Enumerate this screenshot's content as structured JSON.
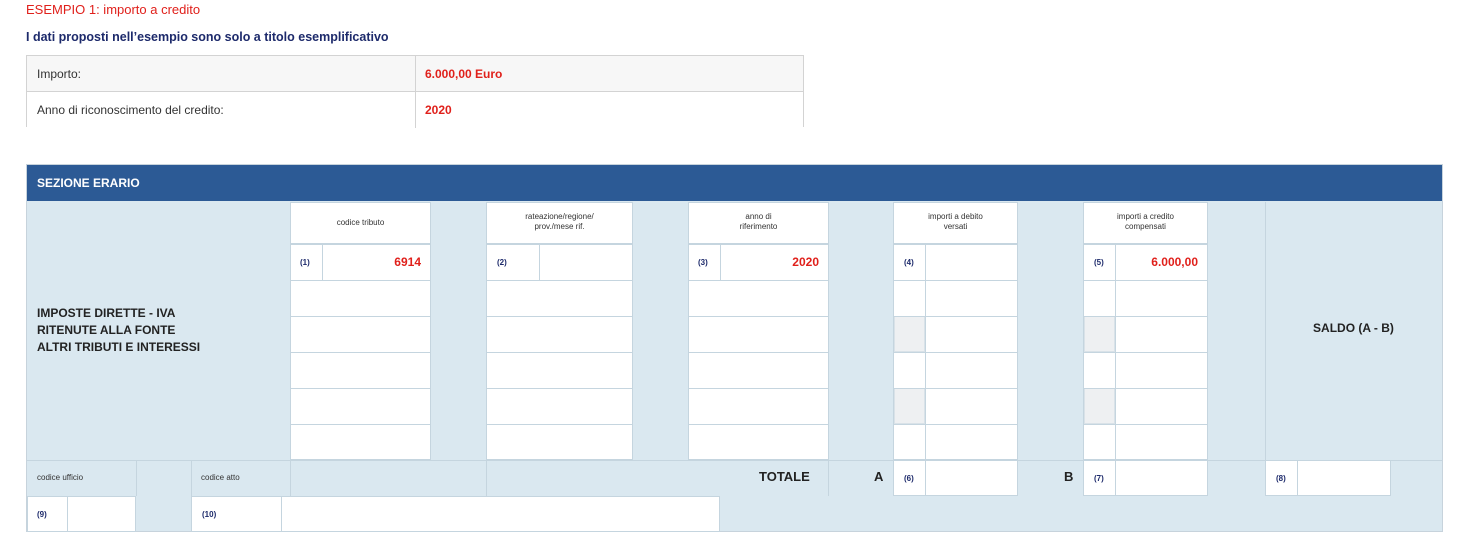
{
  "heading": "ESEMPIO 1: importo a credito",
  "subheading": "I dati proposti nell’esempio sono solo a titolo esemplificativo",
  "info": {
    "rows": [
      {
        "label": "Importo:",
        "value": "6.000,00 Euro"
      },
      {
        "label": "Anno di riconoscimento del credito:",
        "value": "2020"
      }
    ]
  },
  "section": {
    "title": "SEZIONE ERARIO",
    "left_label": {
      "line1": "IMPOSTE DIRETTE - IVA",
      "line2": "RITENUTE ALLA FONTE",
      "line3": "ALTRI TRIBUTI E INTERESSI"
    },
    "columns": [
      {
        "header": "codice tributo",
        "num": "(1)",
        "value": "6914"
      },
      {
        "header_l1": "rateazione/regione/",
        "header_l2": "prov./mese rif.",
        "num": "(2)",
        "value": ""
      },
      {
        "header_l1": "anno di",
        "header_l2": "riferimento",
        "num": "(3)",
        "value": "2020"
      },
      {
        "header_l1": "importi a debito",
        "header_l2": "versati",
        "num": "(4)",
        "value": ""
      },
      {
        "header_l1": "importi a credito",
        "header_l2": "compensati",
        "num": "(5)",
        "value": "6.000,00"
      }
    ],
    "saldo_label": "SALDO (A - B)",
    "footer": {
      "codice_ufficio": "codice ufficio",
      "codice_atto": "codice atto",
      "totale": "TOTALE",
      "a": "A",
      "b": "B",
      "num6": "(6)",
      "num7": "(7)",
      "num8": "(8)",
      "num9": "(9)",
      "num10": "(10)"
    }
  }
}
